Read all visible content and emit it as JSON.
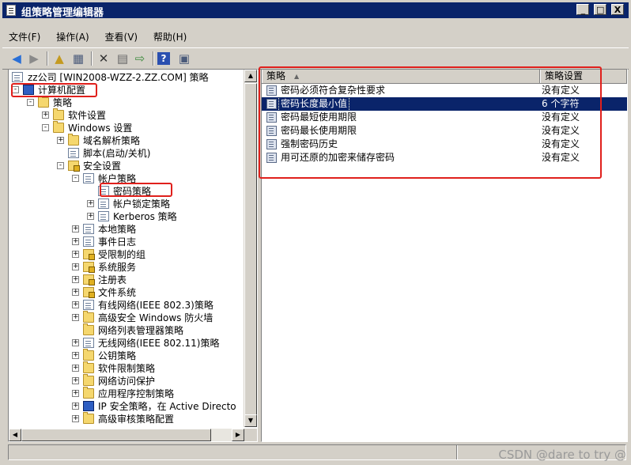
{
  "window": {
    "title": "组策略管理编辑器",
    "buttons": [
      "_",
      "□",
      "X"
    ]
  },
  "menu": [
    {
      "label": "文件(F)"
    },
    {
      "label": "操作(A)"
    },
    {
      "label": "查看(V)"
    },
    {
      "label": "帮助(H)"
    }
  ],
  "toolbar": {
    "icons": [
      "back-icon",
      "forward-icon",
      "up-folder-icon",
      "show-hide-tree-icon",
      "delete-icon",
      "properties-icon",
      "export-icon",
      "help-icon",
      "console-icon"
    ]
  },
  "tree": {
    "root": "zz公司 [WIN2008-WZZ-2.ZZ.COM] 策略",
    "nodes": [
      {
        "id": "computer-config",
        "label": "计算机配置",
        "exp": "-"
      },
      {
        "id": "policies",
        "label": "策略",
        "exp": "-"
      },
      {
        "id": "software-settings",
        "label": "软件设置",
        "exp": "+"
      },
      {
        "id": "windows-settings",
        "label": "Windows 设置",
        "exp": "-"
      },
      {
        "id": "dns-policy",
        "label": "域名解析策略",
        "exp": "+"
      },
      {
        "id": "scripts",
        "label": "脚本(启动/关机)",
        "exp": ""
      },
      {
        "id": "security-settings",
        "label": "安全设置",
        "exp": "-"
      },
      {
        "id": "account-policies",
        "label": "帐户策略",
        "exp": "-"
      },
      {
        "id": "password-policy",
        "label": "密码策略",
        "exp": ""
      },
      {
        "id": "lockout-policy",
        "label": "帐户锁定策略",
        "exp": "+"
      },
      {
        "id": "kerberos-policy",
        "label": "Kerberos 策略",
        "exp": "+"
      },
      {
        "id": "local-policies",
        "label": "本地策略",
        "exp": "+"
      },
      {
        "id": "event-log",
        "label": "事件日志",
        "exp": "+"
      },
      {
        "id": "restricted-groups",
        "label": "受限制的组",
        "exp": "+"
      },
      {
        "id": "system-services",
        "label": "系统服务",
        "exp": "+"
      },
      {
        "id": "registry",
        "label": "注册表",
        "exp": "+"
      },
      {
        "id": "file-system",
        "label": "文件系统",
        "exp": "+"
      },
      {
        "id": "wired-network",
        "label": "有线网络(IEEE 802.3)策略",
        "exp": "+"
      },
      {
        "id": "firewall",
        "label": "高级安全 Windows 防火墙",
        "exp": "+"
      },
      {
        "id": "network-list",
        "label": "网络列表管理器策略",
        "exp": ""
      },
      {
        "id": "wireless-network",
        "label": "无线网络(IEEE 802.11)策略",
        "exp": "+"
      },
      {
        "id": "public-key",
        "label": "公钥策略",
        "exp": "+"
      },
      {
        "id": "software-restriction",
        "label": "软件限制策略",
        "exp": "+"
      },
      {
        "id": "nap",
        "label": "网络访问保护",
        "exp": "+"
      },
      {
        "id": "applocker",
        "label": "应用程序控制策略",
        "exp": "+"
      },
      {
        "id": "ipsec",
        "label": "IP 安全策略，在 Active Directo",
        "exp": "+"
      },
      {
        "id": "audit-policy",
        "label": "高级审核策略配置",
        "exp": "+"
      }
    ]
  },
  "list": {
    "columns": [
      "策略",
      "策略设置"
    ],
    "rows": [
      {
        "name": "密码必须符合复杂性要求",
        "value": "没有定义"
      },
      {
        "name": "密码长度最小值",
        "value": "6 个字符",
        "selected": true
      },
      {
        "name": "密码最短使用期限",
        "value": "没有定义"
      },
      {
        "name": "密码最长使用期限",
        "value": "没有定义"
      },
      {
        "name": "强制密码历史",
        "value": "没有定义"
      },
      {
        "name": "用可还原的加密来储存密码",
        "value": "没有定义"
      }
    ]
  },
  "watermark": "CSDN @dare to try @"
}
